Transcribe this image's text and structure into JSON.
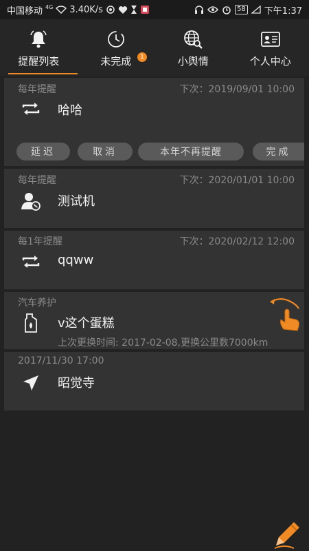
{
  "status_bar": {
    "carrier": "中国移动",
    "network": "4G",
    "speed": "3.40K/s",
    "battery": "58",
    "time": "下午1:37"
  },
  "tabs": [
    {
      "label": "提醒列表",
      "icon": "bell-icon",
      "active": true
    },
    {
      "label": "未完成",
      "icon": "clock-icon",
      "badge": "1"
    },
    {
      "label": "小舆情",
      "icon": "globe-search-icon"
    },
    {
      "label": "个人中心",
      "icon": "id-card-icon"
    }
  ],
  "reminders": [
    {
      "type": "每年提醒",
      "next": "下次：2019/09/01 10:00",
      "title": "哈哈",
      "icon": "repeat-icon",
      "actions": [
        "延迟",
        "取消",
        "本年不再提醒",
        "完成"
      ]
    },
    {
      "type": "每年提醒",
      "next": "下次：2020/01/01 10:00",
      "title": "测试机",
      "icon": "contact-icon"
    },
    {
      "type": "每1年提醒",
      "next": "下次：2020/02/12 12:00",
      "title": "qqww",
      "icon": "repeat-icon"
    },
    {
      "type": "汽车养护",
      "title": "v这个蛋糕",
      "icon": "oil-can-icon",
      "sub": "上次更换时间: 2017-02-08,更换公里数7000km"
    },
    {
      "type": "2017/11/30 17:00",
      "title": "昭觉寺",
      "icon": "navigation-arrow-icon"
    }
  ],
  "colors": {
    "accent": "#f08a24",
    "background": "#222222",
    "card": "#333333",
    "muted_text": "#8a8a8a"
  }
}
